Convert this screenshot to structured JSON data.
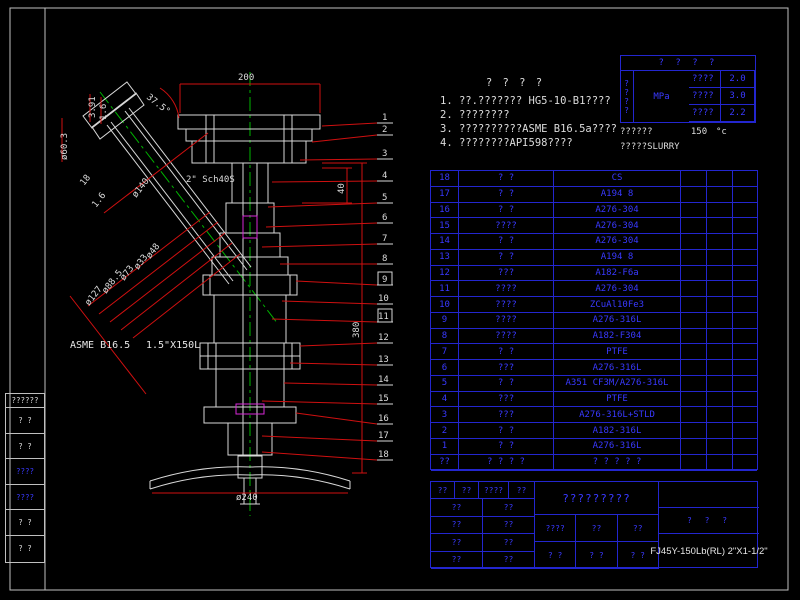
{
  "frame": {
    "left_strip": {
      "header": "??????",
      "rows": [
        "? ?",
        "? ?",
        "????",
        "????",
        "? ?",
        "? ?"
      ]
    }
  },
  "notes": {
    "title": "? ? ? ?",
    "items": [
      "1. ??.??????? HG5-10-B1????",
      "2. ????????",
      "3. ??????????ASME B16.5a????",
      "4. ????????API598????"
    ]
  },
  "spec_table": {
    "title": "? ? ? ?",
    "side_label": "????",
    "rows": [
      [
        "????",
        "2.0"
      ],
      [
        "????",
        "3.0"
      ],
      [
        "????",
        "2.2"
      ]
    ],
    "unit": "MPa",
    "temp_label": "??????",
    "temp_value": "150",
    "temp_unit": "°c",
    "medium": "?????SLURRY"
  },
  "parts_list": {
    "rows": [
      [
        "18",
        "? ?",
        "CS",
        "",
        "",
        ""
      ],
      [
        "17",
        "? ?",
        "A194 8",
        "",
        "",
        ""
      ],
      [
        "16",
        "? ?",
        "A276-304",
        "",
        "",
        ""
      ],
      [
        "15",
        "????",
        "A276-304",
        "",
        "",
        ""
      ],
      [
        "14",
        "? ?",
        "A276-304",
        "",
        "",
        ""
      ],
      [
        "13",
        "? ?",
        "A194 8",
        "",
        "",
        ""
      ],
      [
        "12",
        "???",
        "A182-F6a",
        "",
        "",
        ""
      ],
      [
        "11",
        "????",
        "A276-304",
        "",
        "",
        ""
      ],
      [
        "10",
        "????",
        "ZCuAl10Fe3",
        "",
        "",
        ""
      ],
      [
        "9",
        "????",
        "A276-316L",
        "",
        "",
        ""
      ],
      [
        "8",
        "????",
        "A182-F304",
        "",
        "",
        ""
      ],
      [
        "7",
        "? ?",
        "PTFE",
        "",
        "",
        ""
      ],
      [
        "6",
        "???",
        "A276-316L",
        "",
        "",
        ""
      ],
      [
        "5",
        "? ?",
        "A351 CF3M/A276-316L",
        "",
        "",
        ""
      ],
      [
        "4",
        "???",
        "PTFE",
        "",
        "",
        ""
      ],
      [
        "3",
        "???",
        "A276-316L+STLD",
        "",
        "",
        ""
      ],
      [
        "2",
        "? ?",
        "A182-316L",
        "",
        "",
        ""
      ],
      [
        "1",
        "? ?",
        "A276-316L",
        "",
        "",
        ""
      ]
    ],
    "footer": [
      "??",
      "? ? ? ?",
      "? ? ? ? ?",
      "",
      "",
      ""
    ]
  },
  "title_block": {
    "rev_row": [
      "??",
      "??",
      "????",
      "??"
    ],
    "sign_rows": [
      [
        "??",
        "??"
      ],
      [
        "??",
        "??"
      ],
      [
        "??",
        "??"
      ],
      [
        "??",
        "??"
      ]
    ],
    "product_name": "?????????",
    "mid_row1": [
      "????",
      "??",
      "??"
    ],
    "mid_row2": [
      "? ?",
      "? ?",
      "? ?"
    ],
    "stage_label": "? ? ?",
    "model": "FJ45Y-150Lb(RL) 2\"X1-1/2\""
  },
  "drawing": {
    "balloons": [
      "1",
      "2",
      "3",
      "4",
      "5",
      "6",
      "7",
      "8",
      "9",
      "10",
      "11",
      "12",
      "13",
      "14",
      "15",
      "16",
      "17",
      "18"
    ],
    "dims": {
      "top_width": "200",
      "angle": "37.5°",
      "stub_a": "3.91",
      "stub_b": "1.6",
      "pipe_od": "ø60.3",
      "pipe_spec": "2\" Sch40S",
      "branch_a": "18",
      "branch_b": "1.6",
      "branch_od": "ø140",
      "d48": "ø48",
      "d33": "ø33",
      "d73": "ø73",
      "d88": "ø88.5",
      "d127": "ø127",
      "h40": "40",
      "h380": "380",
      "wheel_od": "ø240",
      "flange_std": "ASME B16.5",
      "flange_size": "1.5\"X150L"
    }
  }
}
